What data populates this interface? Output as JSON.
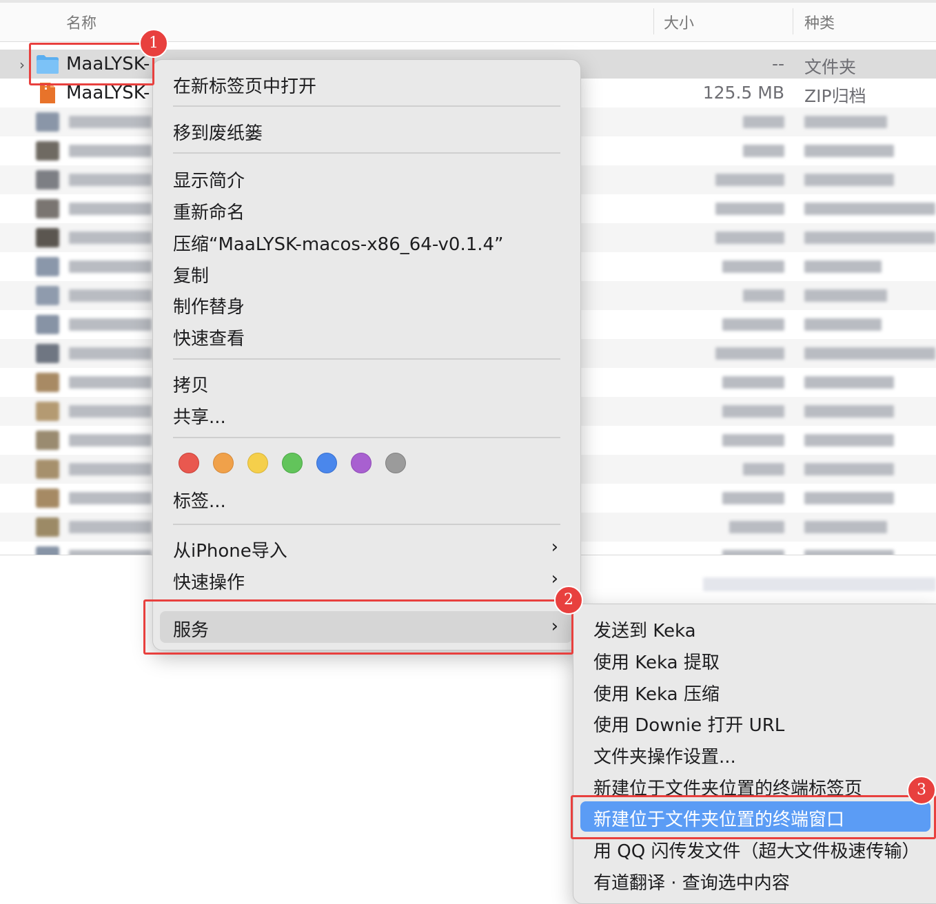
{
  "finder": {
    "headers": {
      "name": "名称",
      "size": "大小",
      "kind": "种类"
    },
    "rows": [
      {
        "name": "MaaLYSK-",
        "name_partial_hidden": "-- -- -- -- -- --",
        "size": "--",
        "kind": "文件夹",
        "icon": "folder-icon",
        "selected": true
      },
      {
        "name": "MaaLYSK-",
        "size": "125.5 MB",
        "kind": "ZIP归档",
        "icon": "zip-archive-icon",
        "selected": false
      }
    ]
  },
  "context_menu": {
    "items": {
      "open_new_tab": "在新标签页中打开",
      "move_to_trash": "移到废纸篓",
      "get_info": "显示简介",
      "rename": "重新命名",
      "compress": "压缩“MaaLYSK-macos-x86_64-v0.1.4”",
      "duplicate": "复制",
      "make_alias": "制作替身",
      "quick_look": "快速查看",
      "copy": "拷贝",
      "share": "共享...",
      "tags": "标签...",
      "import_iphone": "从iPhone导入",
      "quick_actions": "快速操作",
      "services": "服务"
    },
    "tag_colors": [
      "#e9584f",
      "#f0a14a",
      "#f5cf4b",
      "#62c45b",
      "#4a87ec",
      "#a860d0",
      "#9b9b9b"
    ],
    "chevron": "›"
  },
  "services_submenu": {
    "items": [
      "发送到 Keka",
      "使用 Keka 提取",
      "使用 Keka 压缩",
      "使用 Downie 打开 URL",
      "文件夹操作设置...",
      "新建位于文件夹位置的终端标签页",
      "新建位于文件夹位置的终端窗口",
      "用 QQ 闪传发文件（超大文件极速传输）",
      "有道翻译 · 查询选中内容"
    ],
    "highlighted_index": 6
  },
  "annotations": {
    "badges": [
      "1",
      "2",
      "3"
    ],
    "highlight_color": "#e8403e"
  }
}
